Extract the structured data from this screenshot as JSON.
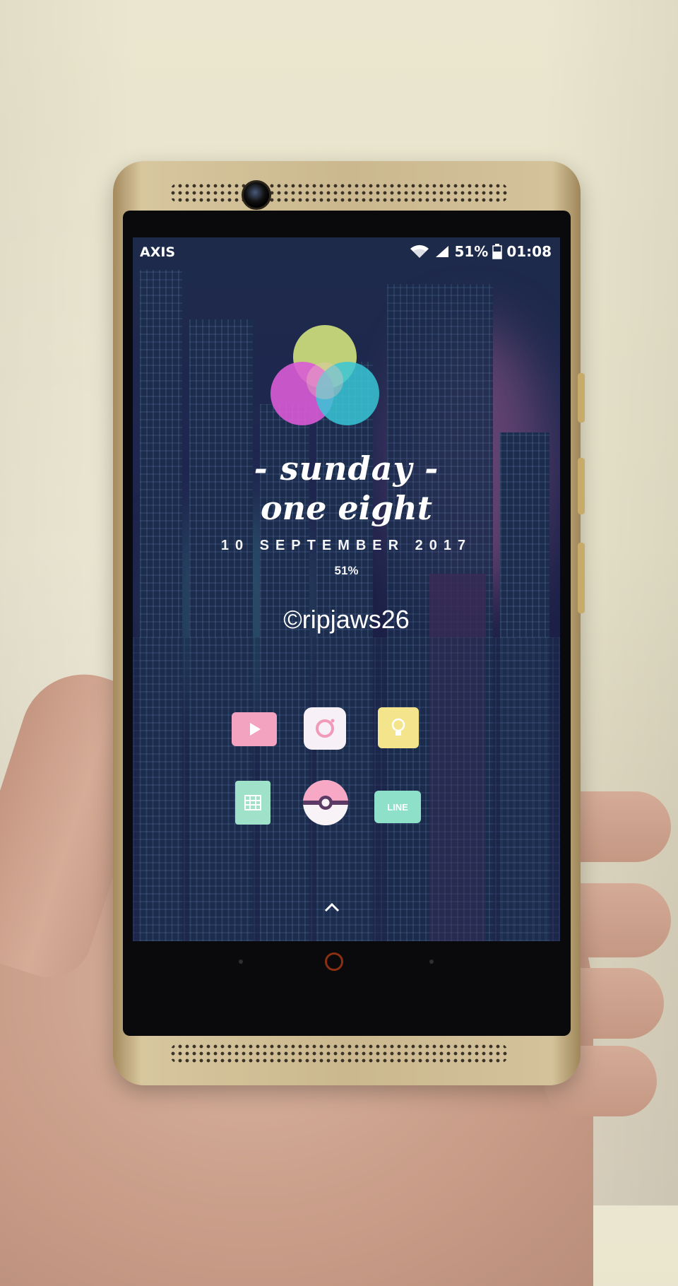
{
  "status_bar": {
    "carrier": "AXIS",
    "battery_percent": "51%",
    "time": "01:08",
    "icons": [
      "wifi-icon",
      "signal-icon",
      "battery-icon"
    ]
  },
  "widget": {
    "day_label": "- sunday -",
    "time_words": "one eight",
    "date": "10 SEPTEMBER 2017",
    "battery": "51%",
    "credit": "©ripjaws26"
  },
  "dock": {
    "row1": [
      {
        "name": "youtube-app-icon",
        "color": "#f3a3bf"
      },
      {
        "name": "instagram-app-icon",
        "color": "#f7f0f6"
      },
      {
        "name": "keep-notes-app-icon",
        "color": "#f4e58c"
      }
    ],
    "row2": [
      {
        "name": "sheets-app-icon",
        "color": "#9fe2c9"
      },
      {
        "name": "pokemon-go-app-icon",
        "color": "#f6a8c4"
      },
      {
        "name": "line-app-icon",
        "color": "#8fe0c8"
      }
    ],
    "line_label": "LINE"
  },
  "colors": {
    "logo_yellow": "#c9d97a",
    "logo_magenta": "#d95bd6",
    "logo_cyan": "#38c6d6",
    "phone_gold": "#cbb88f"
  },
  "app_drawer_icon": "chevron-up-icon"
}
